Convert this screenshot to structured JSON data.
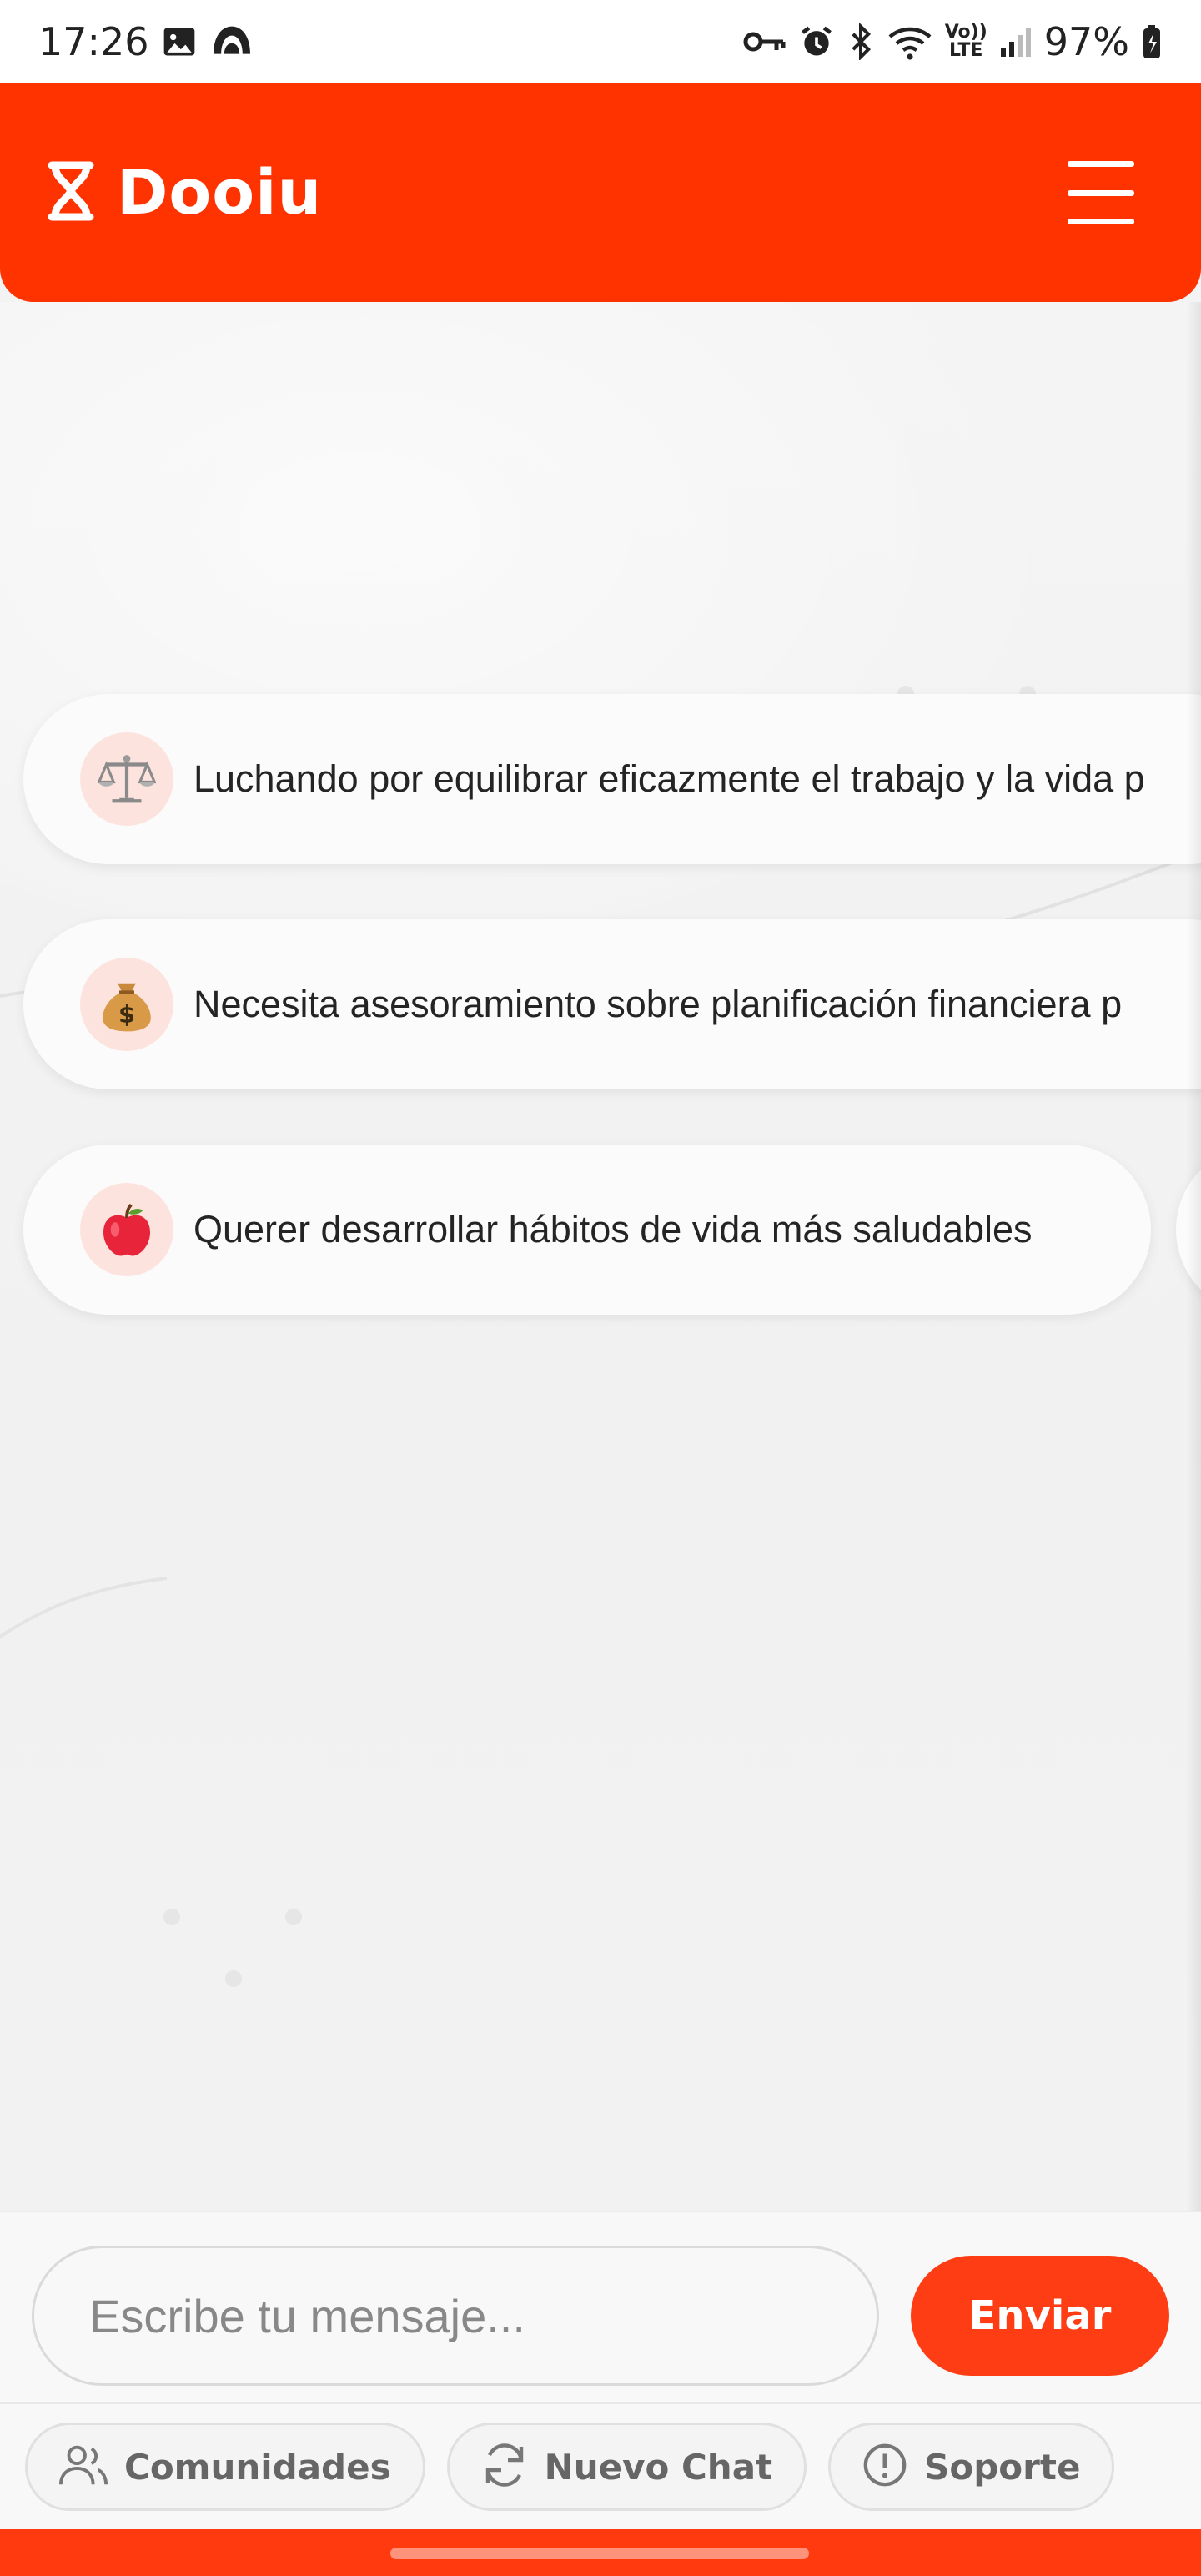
{
  "status_bar": {
    "time": "17:26",
    "battery": "97%",
    "volte_top": "Vo))",
    "volte_bottom": "LTE",
    "icons": [
      "image-icon",
      "cloud-app-icon",
      "vpn-key-icon",
      "alarm-icon",
      "bluetooth-icon",
      "wifi-icon",
      "volte-icon",
      "signal-icon",
      "battery-icon"
    ]
  },
  "header": {
    "brand": "Dooiu",
    "logo_icon": "hourglass-logo-icon",
    "menu_icon": "hamburger-menu-icon",
    "background_color": "#ff3300"
  },
  "suggestions": [
    {
      "emoji": "⚖️",
      "icon": "balance-scale-icon",
      "text": "Luchando por equilibrar eficazmente el trabajo y la vida p"
    },
    {
      "emoji": "💰",
      "icon": "money-bag-icon",
      "text": "Necesita asesoramiento sobre planificación financiera p"
    },
    {
      "emoji": "🍎",
      "icon": "apple-icon",
      "text": "Querer desarrollar hábitos de vida más saludables"
    }
  ],
  "composer": {
    "placeholder": "Escribe tu mensaje...",
    "value": "",
    "send_label": "Enviar",
    "accent_color": "#ff3d14"
  },
  "toolbar": {
    "items": [
      {
        "label": "Comunidades",
        "icon": "users-icon"
      },
      {
        "label": "Nuevo Chat",
        "icon": "refresh-icon"
      },
      {
        "label": "Soporte",
        "icon": "alert-circle-icon"
      }
    ]
  }
}
